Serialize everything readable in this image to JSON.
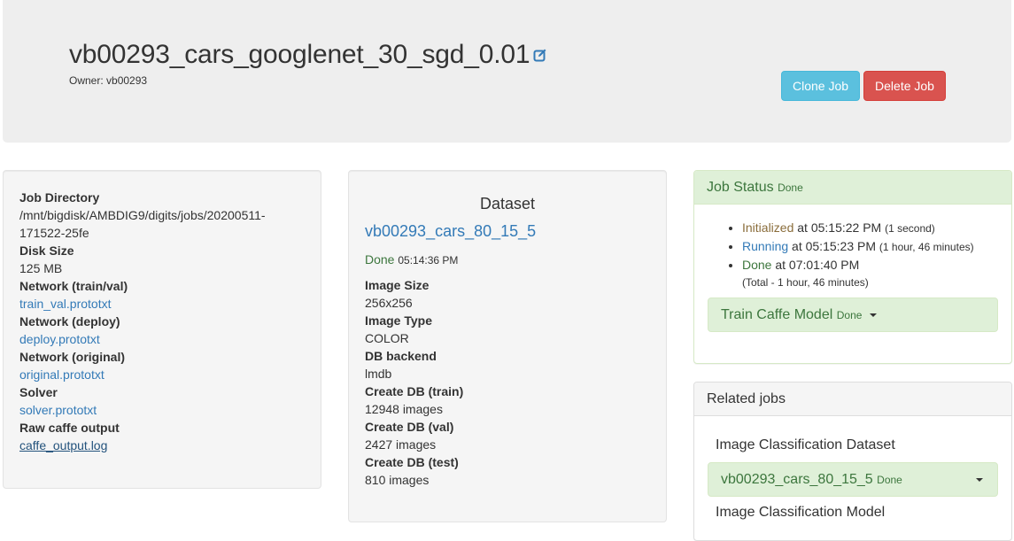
{
  "header": {
    "title": "vb00293_cars_googlenet_30_sgd_0.01",
    "owner_label": "Owner:",
    "owner": "vb00293",
    "clone_label": "Clone Job",
    "delete_label": "Delete Job"
  },
  "job_info": {
    "dir_label": "Job Directory",
    "dir_line1": "/mnt/bigdisk/AMBDIG9/digits/jobs/20200511-",
    "dir_line2": "171522-25fe",
    "disk_label": "Disk Size",
    "disk_value": "125 MB",
    "net_trainval_label": "Network (train/val)",
    "net_trainval_file": "train_val.prototxt",
    "net_deploy_label": "Network (deploy)",
    "net_deploy_file": "deploy.prototxt",
    "net_original_label": "Network (original)",
    "net_original_file": "original.prototxt",
    "solver_label": "Solver",
    "solver_file": "solver.prototxt",
    "raw_output_label": "Raw caffe output",
    "raw_output_file": "caffe_output.log"
  },
  "dataset": {
    "heading": "Dataset",
    "name": "vb00293_cars_80_15_5",
    "status": "Done",
    "status_time": "05:14:36 PM",
    "fields": [
      {
        "label": "Image Size",
        "value": "256x256"
      },
      {
        "label": "Image Type",
        "value": "COLOR"
      },
      {
        "label": "DB backend",
        "value": "lmdb"
      },
      {
        "label": "Create DB (train)",
        "value": "12948 images"
      },
      {
        "label": "Create DB (val)",
        "value": "2427 images"
      },
      {
        "label": "Create DB (test)",
        "value": "810 images"
      }
    ]
  },
  "job_status": {
    "title": "Job Status",
    "state": "Done",
    "events": [
      {
        "name": "Initialized",
        "at": "at 05:15:22 PM",
        "duration": "(1 second)"
      },
      {
        "name": "Running",
        "at": "at 05:15:23 PM",
        "duration": "(1 hour, 46 minutes)"
      },
      {
        "name": "Done",
        "at": "at 07:01:40 PM",
        "duration": ""
      }
    ],
    "total": "(Total - 1 hour, 46 minutes)",
    "task_name": "Train Caffe Model",
    "task_state": "Done"
  },
  "related": {
    "title": "Related jobs",
    "section1": "Image Classification Dataset",
    "dataset_job": "vb00293_cars_80_15_5",
    "dataset_job_state": "Done",
    "section2": "Image Classification Model"
  },
  "colors": {
    "clone": "#5bc0de",
    "delete": "#d9534f",
    "success_bg": "#dff0d8",
    "success_text": "#3c763d",
    "link": "#337ab7"
  },
  "icons": [
    "edit-icon",
    "caret-down-icon"
  ]
}
